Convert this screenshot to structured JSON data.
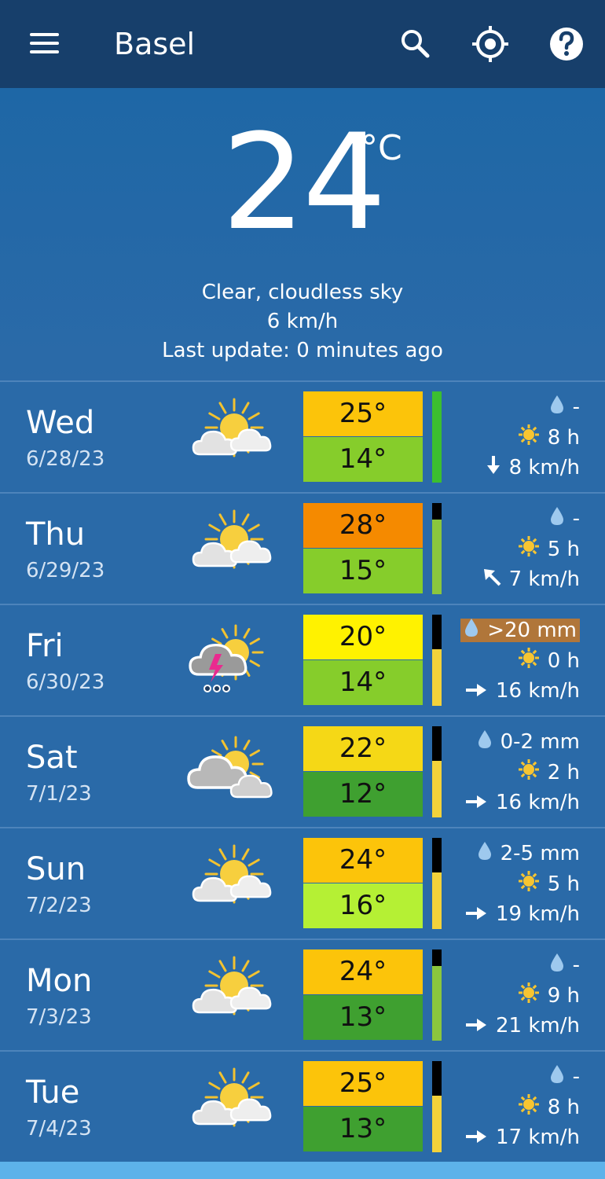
{
  "appbar": {
    "city": "Basel",
    "icons": [
      "menu-icon",
      "search-icon",
      "locate-icon",
      "help-icon"
    ]
  },
  "current": {
    "temperature": "24",
    "unit": "°C",
    "condition": "Clear, cloudless sky",
    "wind": "6 km/h",
    "last_update": "Last update: 0 minutes ago"
  },
  "forecast": [
    {
      "day": "Wed",
      "date": "6/28/23",
      "icon": "sun-cloud-icon",
      "high": "25°",
      "low": "14°",
      "high_color": "#fcc40a",
      "low_color": "#86cd2b",
      "bar_fraction": 1.0,
      "bar_color": "#3cbf2f",
      "precip": "-",
      "precip_highlight": false,
      "sun": "8 h",
      "wind": "8 km/h",
      "wind_dir": "down-arrow-icon"
    },
    {
      "day": "Thu",
      "date": "6/29/23",
      "icon": "sun-cloud-icon",
      "high": "28°",
      "low": "15°",
      "high_color": "#f58a00",
      "low_color": "#86cd2b",
      "bar_fraction": 0.82,
      "bar_color": "#8bc63d",
      "precip": "-",
      "precip_highlight": false,
      "sun": "5 h",
      "wind": "7 km/h",
      "wind_dir": "up-left-arrow-icon"
    },
    {
      "day": "Fri",
      "date": "6/30/23",
      "icon": "thunderstorm-icon",
      "high": "20°",
      "low": "14°",
      "high_color": "#fff200",
      "low_color": "#86cd2b",
      "bar_fraction": 0.62,
      "bar_color": "#f3d23a",
      "precip": ">20 mm",
      "precip_highlight": true,
      "sun": "0 h",
      "wind": "16 km/h",
      "wind_dir": "right-arrow-icon"
    },
    {
      "day": "Sat",
      "date": "7/1/23",
      "icon": "cloudy-sun-icon",
      "high": "22°",
      "low": "12°",
      "high_color": "#f5d816",
      "low_color": "#3fa030",
      "bar_fraction": 0.62,
      "bar_color": "#f3d23a",
      "precip": "0-2 mm",
      "precip_highlight": false,
      "sun": "2 h",
      "wind": "16 km/h",
      "wind_dir": "right-arrow-icon"
    },
    {
      "day": "Sun",
      "date": "7/2/23",
      "icon": "sun-cloud-icon",
      "high": "24°",
      "low": "16°",
      "high_color": "#fcc40a",
      "low_color": "#b5f034",
      "bar_fraction": 0.62,
      "bar_color": "#f3d23a",
      "precip": "2-5 mm",
      "precip_highlight": false,
      "sun": "5 h",
      "wind": "19 km/h",
      "wind_dir": "right-arrow-icon"
    },
    {
      "day": "Mon",
      "date": "7/3/23",
      "icon": "sun-cloud-icon",
      "high": "24°",
      "low": "13°",
      "high_color": "#fcc40a",
      "low_color": "#3fa030",
      "bar_fraction": 0.82,
      "bar_color": "#8bc63d",
      "precip": "-",
      "precip_highlight": false,
      "sun": "9 h",
      "wind": "21 km/h",
      "wind_dir": "right-arrow-icon"
    },
    {
      "day": "Tue",
      "date": "7/4/23",
      "icon": "sun-cloud-icon",
      "high": "25°",
      "low": "13°",
      "high_color": "#fcc40a",
      "low_color": "#3fa030",
      "bar_fraction": 0.62,
      "bar_color": "#f3d23a",
      "precip": "-",
      "precip_highlight": false,
      "sun": "8 h",
      "wind": "17 km/h",
      "wind_dir": "right-arrow-icon"
    }
  ]
}
